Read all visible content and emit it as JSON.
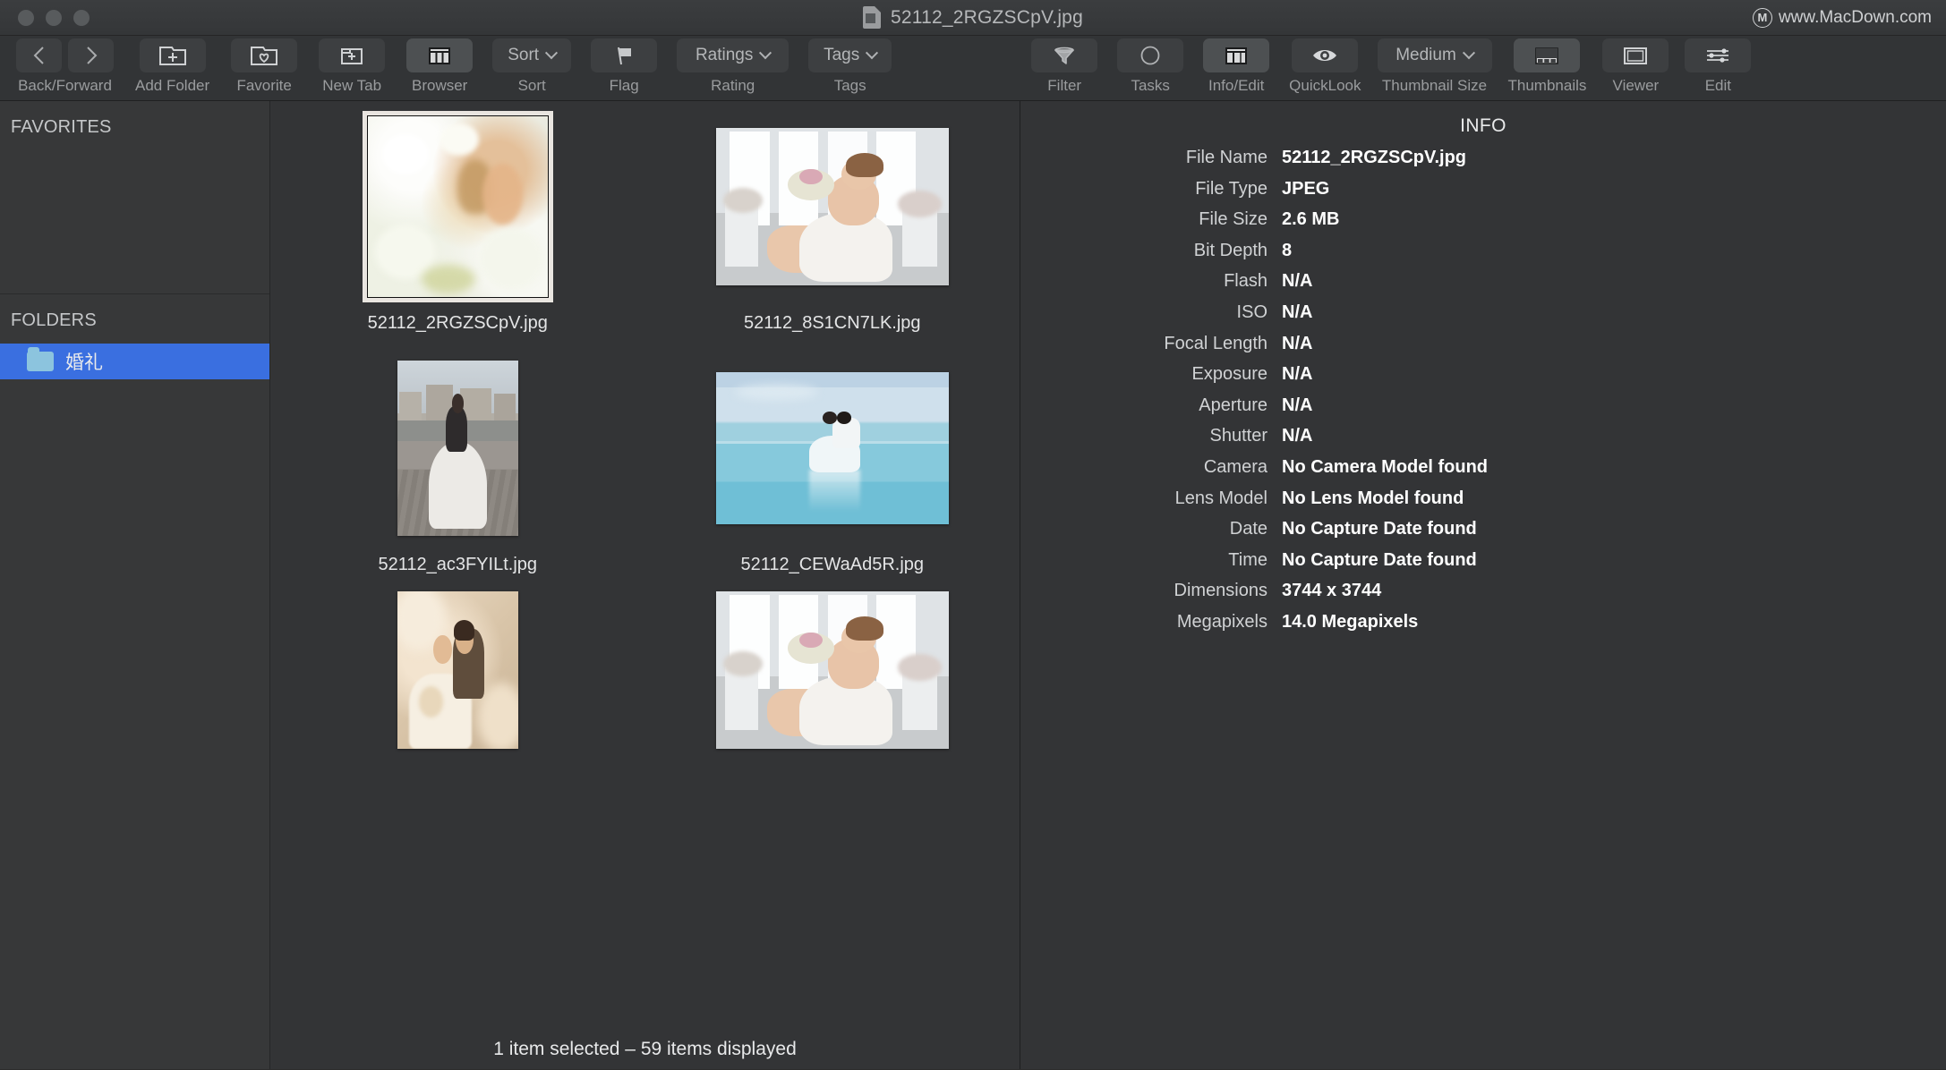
{
  "window": {
    "title": "52112_2RGZSCpV.jpg",
    "brand": "www.MacDown.com",
    "brand_mark": "M",
    "title_icon": "document-icon",
    "traffic_lights": [
      "close",
      "minimize",
      "zoom"
    ]
  },
  "toolbar": {
    "items": [
      {
        "label": "Back/Forward",
        "name": "back-forward",
        "type": "segmented",
        "icons": [
          "chevron-left-icon",
          "chevron-right-icon"
        ],
        "active": false
      },
      {
        "label": "Add Folder",
        "name": "add-folder",
        "type": "icon",
        "icon": "folder-plus-icon",
        "active": false
      },
      {
        "label": "Favorite",
        "name": "favorite",
        "type": "icon",
        "icon": "folder-heart-icon",
        "active": false
      },
      {
        "label": "New Tab",
        "name": "new-tab",
        "type": "icon",
        "icon": "folder-new-tab-icon",
        "active": false
      },
      {
        "label": "Browser",
        "name": "browser",
        "type": "icon",
        "icon": "columns-icon",
        "active": true
      },
      {
        "label": "Sort",
        "name": "sort",
        "type": "menu",
        "menu_label": "Sort",
        "active": false
      },
      {
        "label": "Flag",
        "name": "flag",
        "type": "icon",
        "icon": "flag-icon",
        "active": false
      },
      {
        "label": "Rating",
        "name": "rating",
        "type": "menu",
        "menu_label": "Ratings",
        "active": false
      },
      {
        "label": "Tags",
        "name": "tags",
        "type": "menu",
        "menu_label": "Tags",
        "active": false
      },
      {
        "label": "Filter",
        "name": "filter",
        "type": "icon",
        "icon": "funnel-icon",
        "active": false
      },
      {
        "label": "Tasks",
        "name": "tasks",
        "type": "icon",
        "icon": "circle-icon",
        "active": false
      },
      {
        "label": "Info/Edit",
        "name": "info-edit",
        "type": "icon",
        "icon": "table-icon",
        "active": true
      },
      {
        "label": "QuickLook",
        "name": "quicklook",
        "type": "icon",
        "icon": "eye-icon",
        "active": false
      },
      {
        "label": "Thumbnail Size",
        "name": "thumbnail-size",
        "type": "menu",
        "menu_label": "Medium",
        "active": false
      },
      {
        "label": "Thumbnails",
        "name": "thumbnails",
        "type": "icon",
        "icon": "thumbnails-icon",
        "active": true
      },
      {
        "label": "Viewer",
        "name": "viewer",
        "type": "icon",
        "icon": "rectangle-icon",
        "active": false
      },
      {
        "label": "Edit",
        "name": "edit",
        "type": "icon",
        "icon": "sliders-icon",
        "active": false
      }
    ]
  },
  "sidebar": {
    "favorites": {
      "header": "FAVORITES",
      "items": []
    },
    "folders": {
      "header": "FOLDERS",
      "items": [
        {
          "label": "婚礼",
          "icon": "folder-icon",
          "selected": true
        }
      ]
    },
    "selection_color": "#3a6fe0"
  },
  "browser": {
    "thumbnails": [
      {
        "label": "52112_2RGZSCpV.jpg",
        "selected": true,
        "style": "p1"
      },
      {
        "label": "52112_8S1CN7LK.jpg",
        "selected": false,
        "style": "p2"
      },
      {
        "label": "52112_ac3FYILt.jpg",
        "selected": false,
        "style": "p3"
      },
      {
        "label": "52112_CEWaAd5R.jpg",
        "selected": false,
        "style": "p4"
      },
      {
        "label": "",
        "selected": false,
        "style": "p5"
      },
      {
        "label": "",
        "selected": false,
        "style": "p2"
      }
    ],
    "status": "1 item selected – 59 items displayed"
  },
  "info": {
    "title": "INFO",
    "rows": [
      {
        "key": "File Name",
        "value": "52112_2RGZSCpV.jpg"
      },
      {
        "key": "File Type",
        "value": "JPEG"
      },
      {
        "key": "File Size",
        "value": "2.6 MB"
      },
      {
        "key": "Bit Depth",
        "value": "8"
      },
      {
        "key": "Flash",
        "value": "N/A"
      },
      {
        "key": "ISO",
        "value": "N/A"
      },
      {
        "key": "Focal Length",
        "value": "N/A"
      },
      {
        "key": "Exposure",
        "value": "N/A"
      },
      {
        "key": "Aperture",
        "value": "N/A"
      },
      {
        "key": "Shutter",
        "value": "N/A"
      },
      {
        "key": "Camera",
        "value": "No Camera Model found"
      },
      {
        "key": "Lens Model",
        "value": "No Lens Model found"
      },
      {
        "key": "Date",
        "value": "No Capture Date found"
      },
      {
        "key": "Time",
        "value": "No Capture Date found"
      },
      {
        "key": "Dimensions",
        "value": "3744 x 3744"
      },
      {
        "key": "Megapixels",
        "value": "14.0 Megapixels"
      }
    ]
  }
}
